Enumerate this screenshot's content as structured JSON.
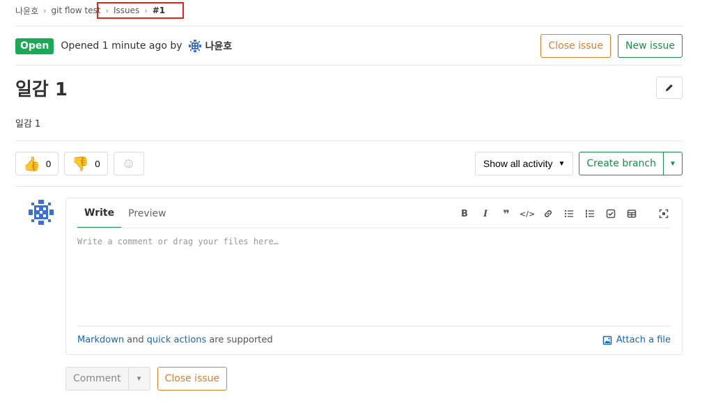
{
  "breadcrumb": {
    "items": [
      "나윤호",
      "git flow test",
      "Issues"
    ],
    "current": "#1",
    "separator": "›"
  },
  "issue": {
    "status": "Open",
    "opened_text": "Opened 1 minute ago by",
    "author": "나윤호",
    "title": "일감 1",
    "description": "일감 1"
  },
  "header_actions": {
    "close_label": "Close issue",
    "new_label": "New issue"
  },
  "reactions": {
    "thumbs_up": {
      "icon": "thumbs-up-icon",
      "glyph": "👍",
      "count": "0"
    },
    "thumbs_down": {
      "icon": "thumbs-down-icon",
      "glyph": "👎",
      "count": "0"
    },
    "add_icon": "smiley-icon",
    "add_glyph": "☺"
  },
  "activity": {
    "filter_label": "Show all activity",
    "create_branch_label": "Create branch"
  },
  "editor": {
    "tabs": [
      "Write",
      "Preview"
    ],
    "placeholder": "Write a comment or drag your files here…",
    "footer": {
      "markdown": "Markdown",
      "and": "and",
      "quick_actions": "quick actions",
      "supported": "are supported",
      "attach": "Attach a file"
    },
    "toolbar_icons": [
      "bold-icon",
      "italic-icon",
      "quote-icon",
      "code-icon",
      "link-icon",
      "bullet-list-icon",
      "numbered-list-icon",
      "task-list-icon",
      "table-icon",
      "fullscreen-icon"
    ]
  },
  "bottom": {
    "comment_label": "Comment",
    "close_label": "Close issue"
  },
  "colors": {
    "success": "#1aaa55",
    "success_border": "#168f48",
    "warning": "#e07e2a",
    "link": "#1068bf",
    "highlight": "#e0241a"
  }
}
